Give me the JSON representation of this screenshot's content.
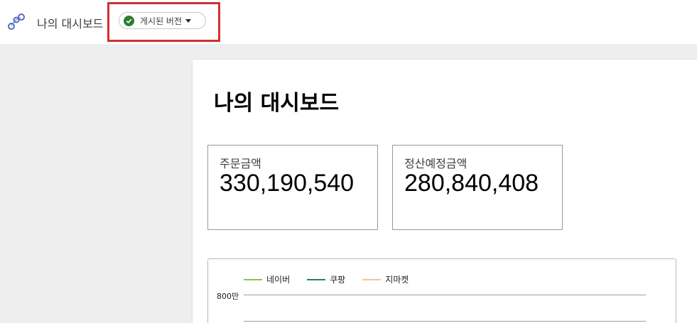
{
  "header": {
    "app_title": "나의 대시보드",
    "logo_icon": "data-studio-logo-icon",
    "version_chip": {
      "label": "게시된 버전",
      "status_icon": "check-circle-icon",
      "status_color": "#2e7d32",
      "dropdown_icon": "caret-down-icon"
    },
    "highlight_color": "#d32f2f"
  },
  "report": {
    "title": "나의 대시보드",
    "scorecards": [
      {
        "label": "주문금액",
        "value": "330,190,540"
      },
      {
        "label": "정산예정금액",
        "value": "280,840,408"
      }
    ]
  },
  "chart_data": {
    "type": "line",
    "series": [
      {
        "name": "네이버",
        "color": "#8bc34a",
        "values": []
      },
      {
        "name": "쿠팡",
        "color": "#2e7d5b",
        "values": []
      },
      {
        "name": "지마켓",
        "color": "#f0c49a",
        "values": []
      }
    ],
    "y_ticks": [
      "800만"
    ]
  }
}
